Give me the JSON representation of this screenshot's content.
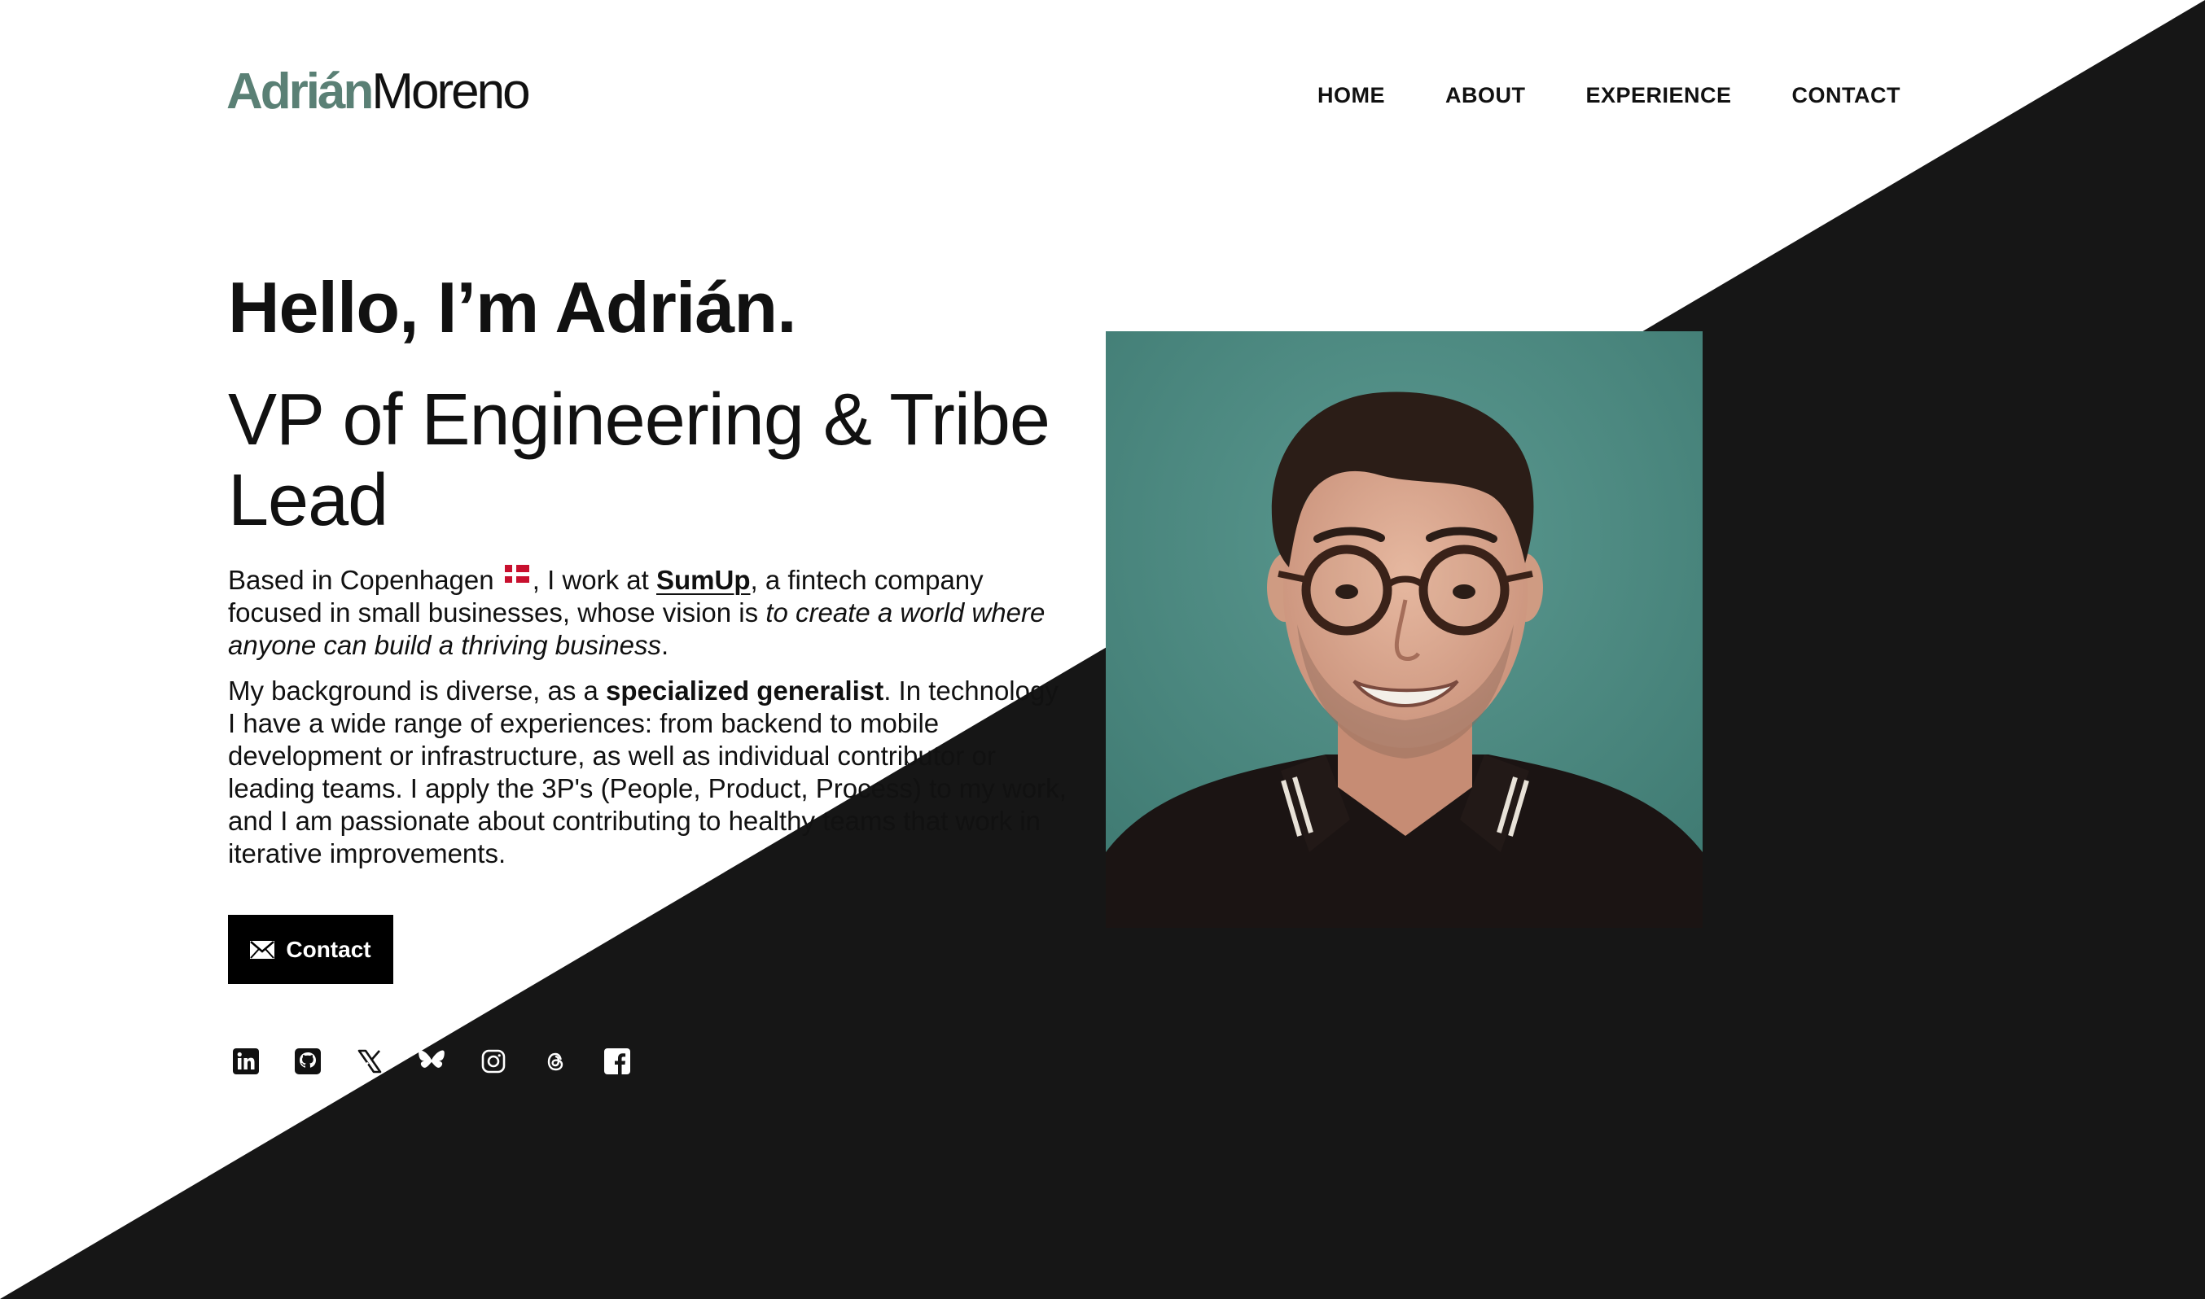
{
  "header": {
    "logo_first": "Adrián",
    "logo_last": "Moreno",
    "nav": [
      {
        "label": "HOME"
      },
      {
        "label": "ABOUT"
      },
      {
        "label": "EXPERIENCE"
      },
      {
        "label": "CONTACT"
      }
    ]
  },
  "hero": {
    "greeting": "Hello, I’m Adrián.",
    "role": "VP of Engineering & Tribe Lead",
    "intro": {
      "part1": "Based in Copenhagen ",
      "part2": ", I work at ",
      "company": "SumUp",
      "part3": ", a fintech company focused in small businesses, whose vision is ",
      "vision": "to create a world where anyone can build a thriving business",
      "part4": "."
    },
    "background": {
      "part1": "My background is diverse, as a ",
      "highlight": "specialized generalist",
      "part2": ". In technology I have a wide range of experiences: from backend to mobile development or infrastructure, as well as individual contributor or leading teams. I apply the 3P's (People, Product, Process) to my work, and I am passionate about contributing to healthy teams that work in iterative improvements."
    },
    "contact_button": "Contact"
  },
  "socials": [
    {
      "icon": "linkedin-icon"
    },
    {
      "icon": "github-icon"
    },
    {
      "icon": "x-icon"
    },
    {
      "icon": "bluesky-icon"
    },
    {
      "icon": "instagram-icon"
    },
    {
      "icon": "threads-icon"
    },
    {
      "icon": "facebook-icon"
    }
  ],
  "colors": {
    "accent": "#5a8075",
    "dark_bg": "#161616",
    "button_bg": "#000000",
    "photo_bg": "#4e8a82"
  }
}
